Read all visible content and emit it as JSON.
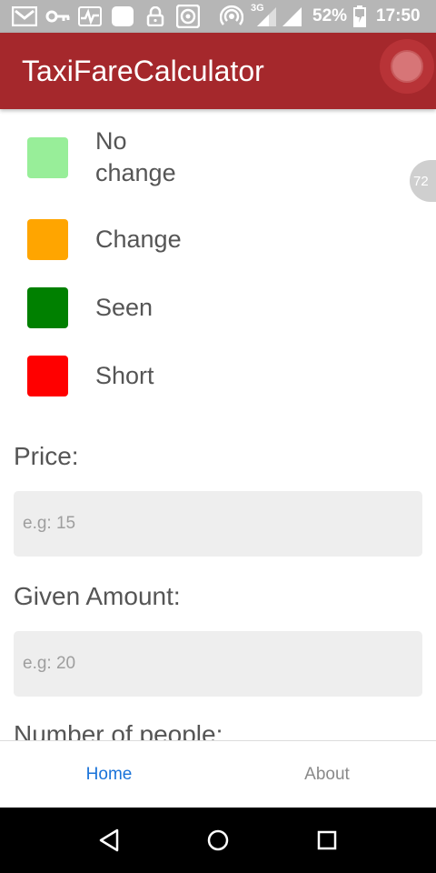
{
  "status_bar": {
    "battery": "52%",
    "time": "17:50",
    "network": "3G",
    "icons": [
      "gmail-icon",
      "key-icon",
      "activity-icon",
      "square-app-icon",
      "lock-icon",
      "media-icon",
      "hotspot-icon",
      "signal-icon",
      "signal-icon",
      "battery-icon"
    ]
  },
  "app_bar": {
    "title": "TaxiFareCalculator",
    "record_icon": "record-icon"
  },
  "legend": {
    "items": [
      {
        "label": "No\nchange",
        "color": "#98ee99"
      },
      {
        "label": "Change",
        "color": "#ffa500"
      },
      {
        "label": "Seen",
        "color": "#008000"
      },
      {
        "label": "Short",
        "color": "#ff0000"
      }
    ]
  },
  "form": {
    "price_label": "Price:",
    "price_placeholder": "e.g: 15",
    "given_label": "Given Amount:",
    "given_placeholder": "e.g: 20",
    "people_label": "Number of people:"
  },
  "side_badge": "72",
  "tabs": [
    {
      "label": "Home",
      "active": true
    },
    {
      "label": "About",
      "active": false
    }
  ],
  "nav": {
    "icons": [
      "back-icon",
      "home-icon",
      "recents-icon"
    ]
  },
  "colors": {
    "app_bar": "#a5282c",
    "tab_active": "#1a73d9"
  }
}
